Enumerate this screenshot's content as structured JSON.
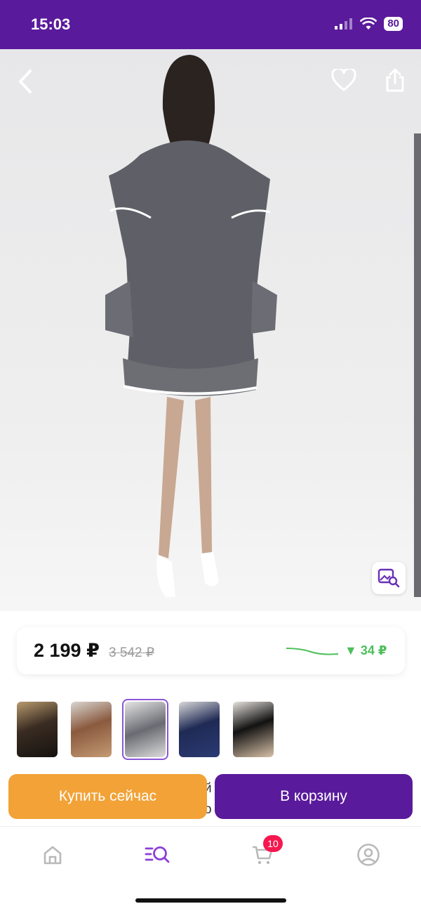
{
  "status_bar": {
    "time": "15:03",
    "battery": "80"
  },
  "product": {
    "price_current": "2 199 ₽",
    "price_old": "3 542 ₽",
    "price_change": "▼ 34 ₽"
  },
  "actions": {
    "buy_now": "Купить сейчас",
    "add_to_cart": "В корзину",
    "partially_hidden_text": "й\nо"
  },
  "nav": {
    "cart_count": "10"
  },
  "colors": {
    "brand": "#5a1a9c",
    "buy": "#f2a236",
    "badge": "#f4184f",
    "drop": "#4cbf5a"
  },
  "icons": [
    "back-arrow-icon",
    "heart-icon",
    "share-icon",
    "image-search-icon",
    "home-icon",
    "catalog-search-icon",
    "cart-icon",
    "profile-icon"
  ]
}
